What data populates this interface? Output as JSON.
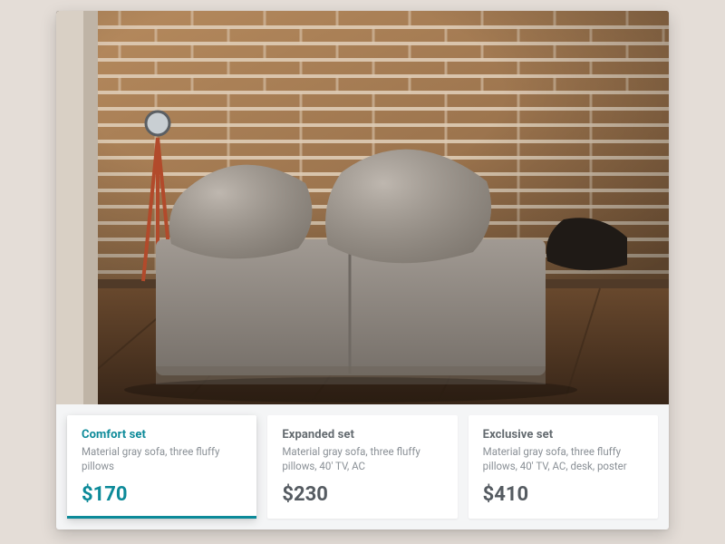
{
  "colors": {
    "accent": "#0c8a99"
  },
  "options": [
    {
      "title": "Comfort set",
      "desc": "Material gray sofa, three fluffy pillows",
      "price": "$170",
      "selected": true
    },
    {
      "title": "Expanded set",
      "desc": "Material gray sofa, three fluffy pillows, 40' TV, AC",
      "price": "$230",
      "selected": false
    },
    {
      "title": "Exclusive set",
      "desc": "Material gray sofa, three fluffy pillows, 40' TV, AC, desk, poster",
      "price": "$410",
      "selected": false
    }
  ]
}
